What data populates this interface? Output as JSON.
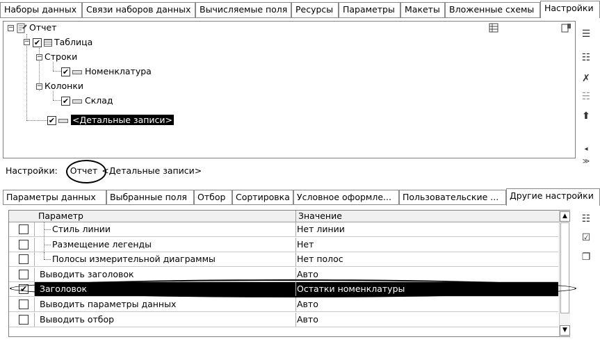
{
  "top_tabs": [
    "Наборы данных",
    "Связи наборов данных",
    "Вычисляемые поля",
    "Ресурсы",
    "Параметры",
    "Макеты",
    "Вложенные схемы",
    "Настройки"
  ],
  "tree": {
    "root": "Отчет",
    "table": "Таблица",
    "rows_group": "Строки",
    "rows_field": "Номенклатура",
    "cols_group": "Колонки",
    "cols_field": "Склад",
    "detail": "<Детальные записи>"
  },
  "settings_row": {
    "label": "Настройки:",
    "crumb_current": "Отчет",
    "crumb_next": "<Детальные записи>"
  },
  "bottom_tabs": [
    "Параметры данных",
    "Выбранные поля",
    "Отбор",
    "Сортировка",
    "Условное оформле...",
    "Пользовательские ...",
    "Другие настройки"
  ],
  "table": {
    "col_param": "Параметр",
    "col_value": "Значение",
    "rows": [
      {
        "name": "Стиль линии",
        "value": "Нет линии",
        "checked": false,
        "nested": true
      },
      {
        "name": "Размещение легенды",
        "value": "Нет",
        "checked": false,
        "nested": true
      },
      {
        "name": "Полосы измерительной диаграммы",
        "value": "Нет полос",
        "checked": false,
        "nested": true
      },
      {
        "name": "Выводить заголовок",
        "value": "Авто",
        "checked": false,
        "nested": false
      },
      {
        "name": "Заголовок",
        "value": "Остатки номенклатуры",
        "checked": true,
        "nested": false
      },
      {
        "name": "Выводить параметры данных",
        "value": "Авто",
        "checked": false,
        "nested": false
      },
      {
        "name": "Выводить отбор",
        "value": "Авто",
        "checked": false,
        "nested": false
      }
    ]
  },
  "glyphs": {
    "check": "✔",
    "minus": "−",
    "up_arrow": "⬆",
    "scroll_up": "▲",
    "scroll_down": "▼",
    "expand": "◂ ≫"
  }
}
